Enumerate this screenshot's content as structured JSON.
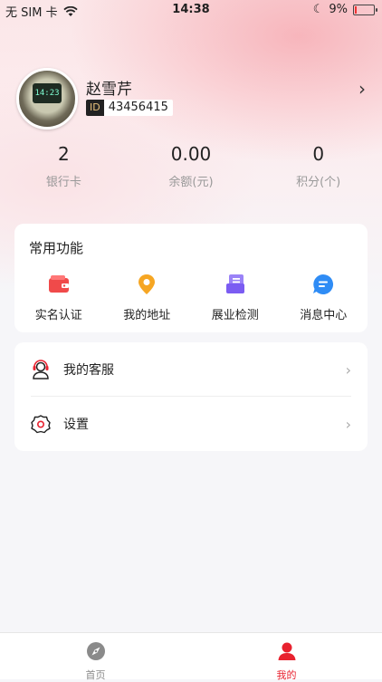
{
  "status_bar": {
    "carrier": "无 SIM 卡",
    "time": "14:38",
    "battery": "9%",
    "battery_level": 0.09
  },
  "profile": {
    "name": "赵雪芹",
    "id_tag": "ID",
    "id_value": "43456415",
    "avatar_screen_text": "14:23"
  },
  "stats": [
    {
      "value": "2",
      "label": "银行卡"
    },
    {
      "value": "0.00",
      "label": "余额(元)"
    },
    {
      "value": "0",
      "label": "积分(个)"
    }
  ],
  "functions": {
    "title": "常用功能",
    "items": [
      {
        "label": "实名认证",
        "icon": "wallet-icon",
        "color": "#f04a4a"
      },
      {
        "label": "我的地址",
        "icon": "location-pin-icon",
        "color": "#f6a623"
      },
      {
        "label": "展业检测",
        "icon": "document-icon",
        "color": "#7b5cf2"
      },
      {
        "label": "消息中心",
        "icon": "message-icon",
        "color": "#2f8cf5"
      }
    ]
  },
  "menu": [
    {
      "label": "我的客服",
      "icon": "customer-service-icon"
    },
    {
      "label": "设置",
      "icon": "gear-icon"
    }
  ],
  "tabs": [
    {
      "label": "首页",
      "icon": "compass-icon",
      "active": false,
      "color": "#8a8a8a"
    },
    {
      "label": "我的",
      "icon": "user-icon",
      "active": true,
      "color": "#e8222f"
    }
  ]
}
